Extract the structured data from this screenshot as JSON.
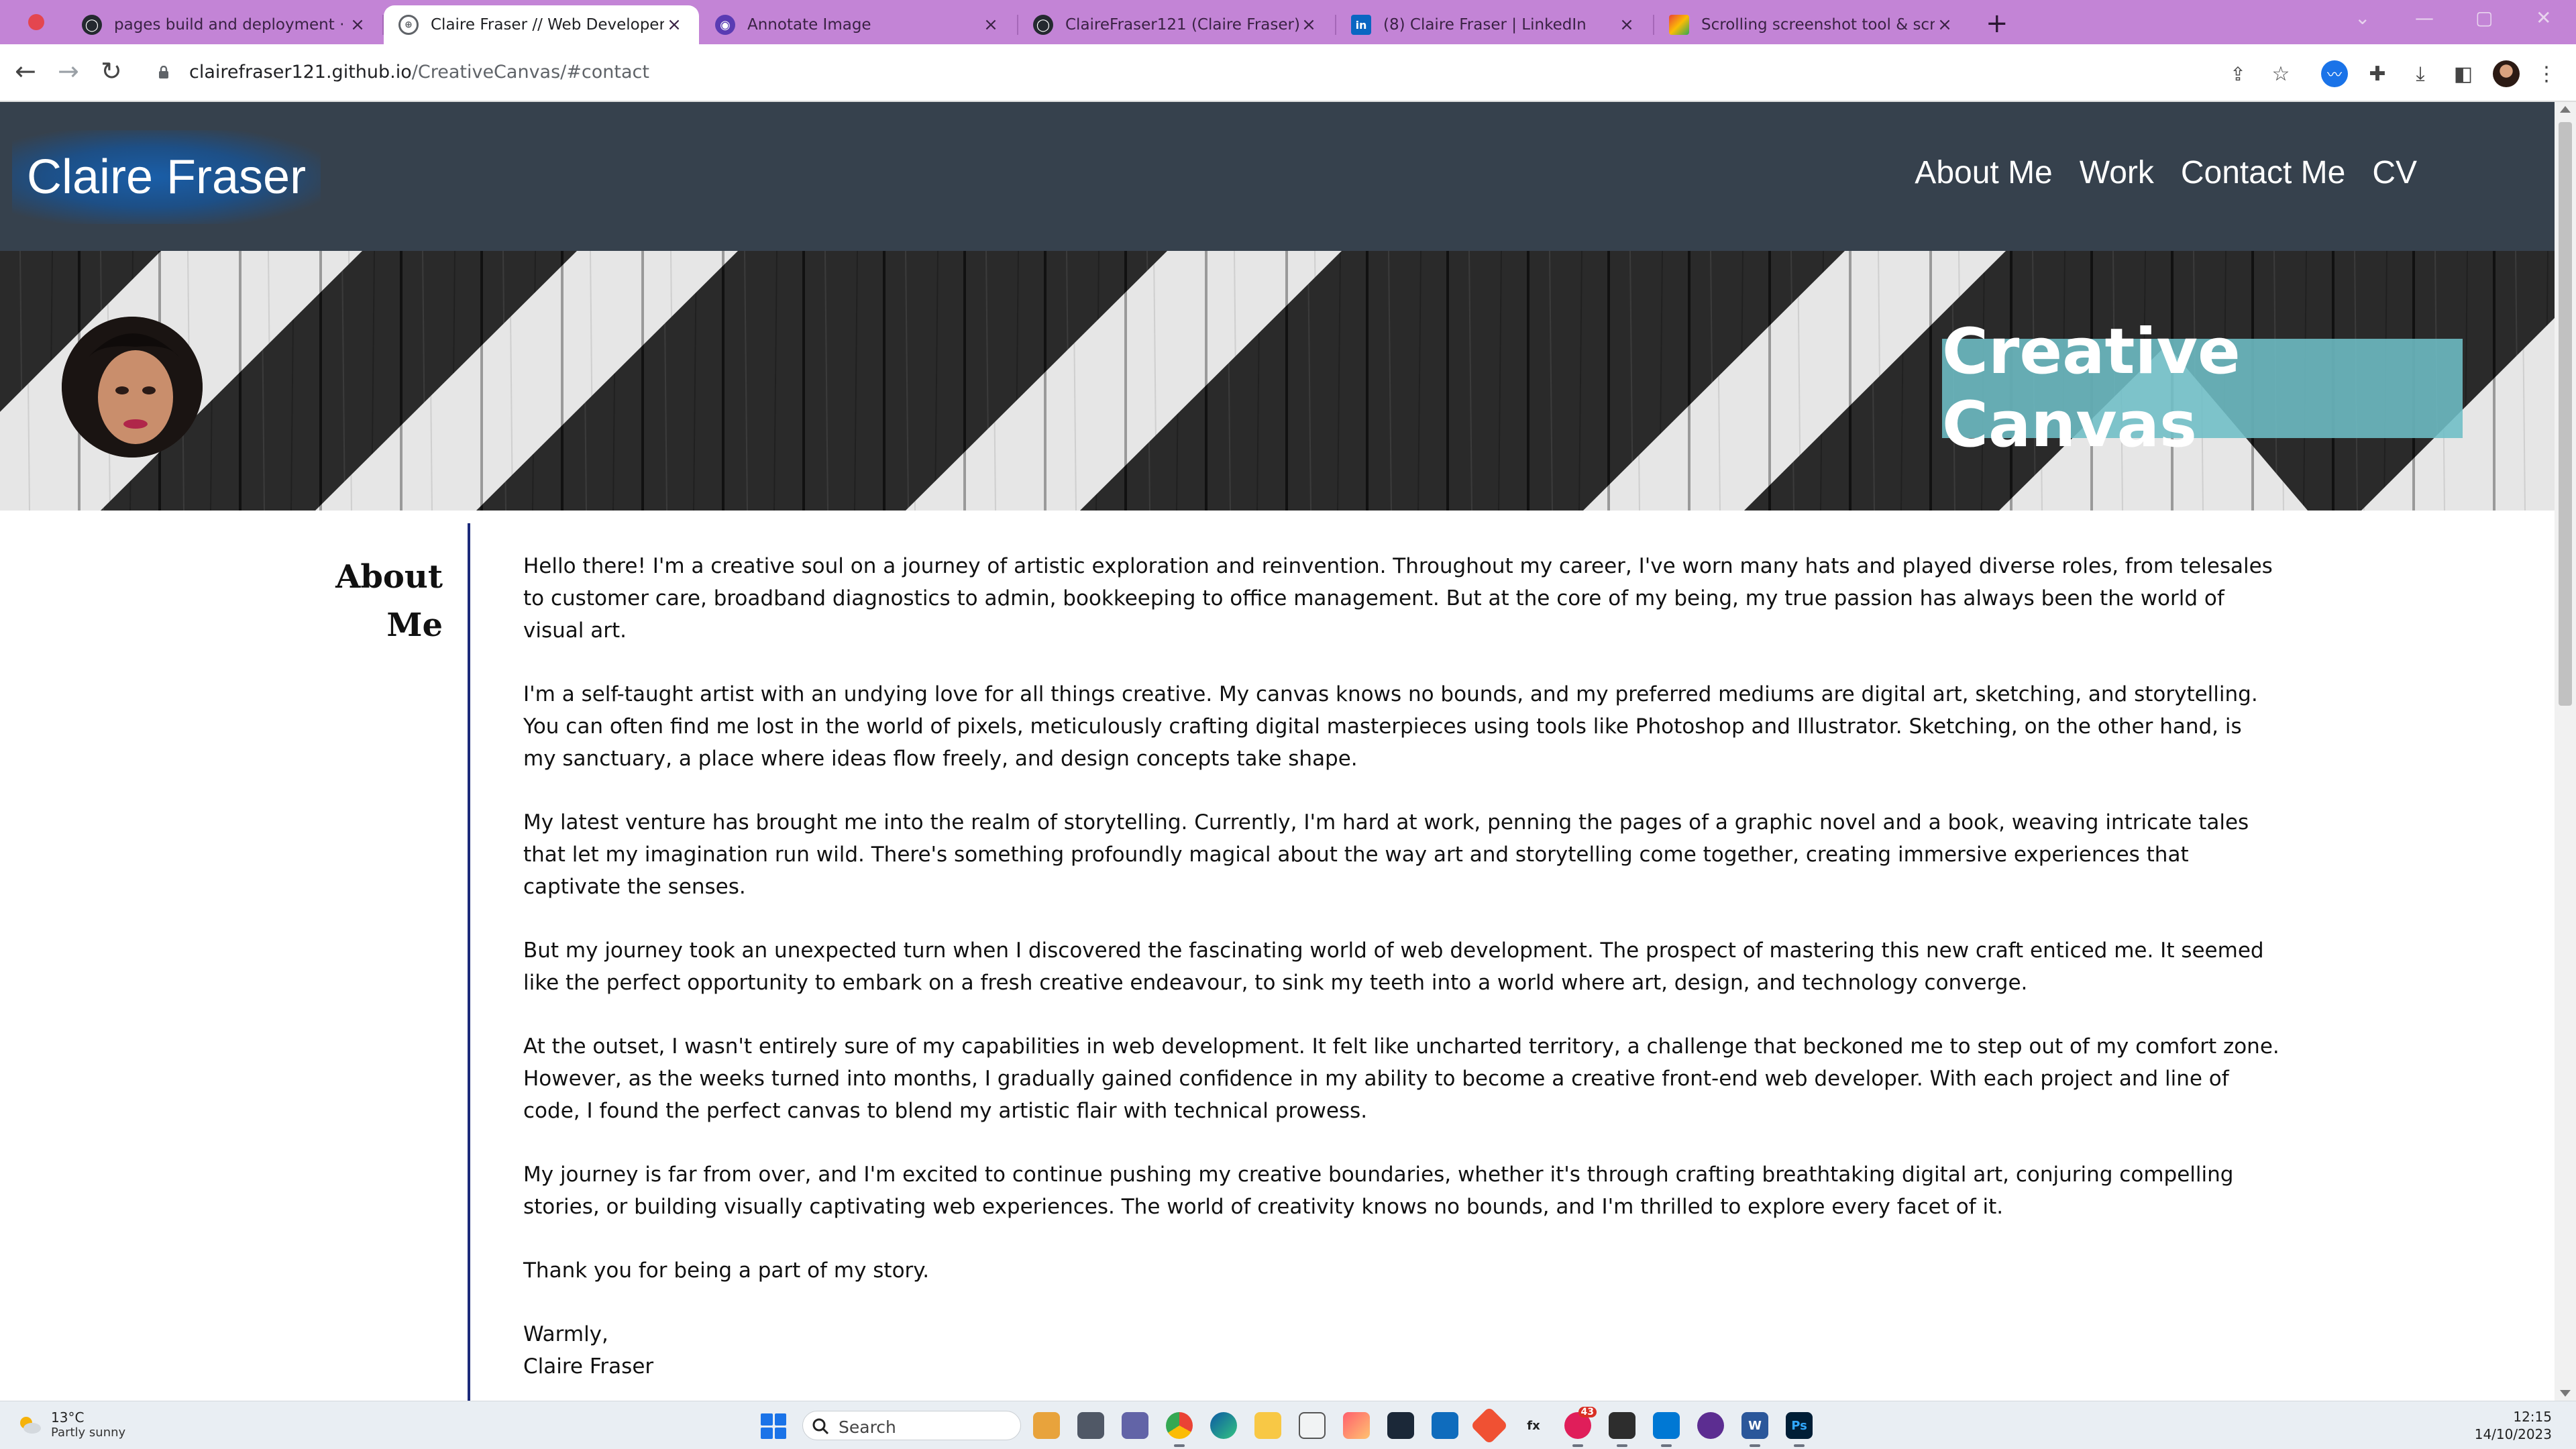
{
  "browser": {
    "tabs": [
      {
        "title": "pages build and deployment · Clai",
        "favicon": "github-icon",
        "active": false
      },
      {
        "title": "Claire Fraser // Web Developer",
        "favicon": "globe-icon",
        "active": true
      },
      {
        "title": "Annotate Image",
        "favicon": "annotate-icon",
        "active": false
      },
      {
        "title": "ClaireFraser121 (Claire Fraser)",
        "favicon": "github-icon",
        "active": false
      },
      {
        "title": "(8) Claire Fraser | LinkedIn",
        "favicon": "linkedin-icon",
        "active": false
      },
      {
        "title": "Scrolling screenshot tool & screen",
        "favicon": "screenshot-tool-icon",
        "active": false
      }
    ],
    "close_glyph": "×",
    "new_tab_glyph": "+",
    "url_host": "clairefraser121.github.io",
    "url_path": "/CreativeCanvas/#contact"
  },
  "site": {
    "brand": "Claire Fraser",
    "nav": [
      "About Me",
      "Work",
      "Contact Me",
      "CV"
    ],
    "hero_title": "Creative Canvas"
  },
  "about": {
    "heading_line1": "About",
    "heading_line2": "Me",
    "paragraphs": [
      "Hello there! I'm a creative soul on a journey of artistic exploration and reinvention. Throughout my career, I've worn many hats and played diverse roles, from telesales to customer care, broadband diagnostics to admin, bookkeeping to office management. But at the core of my being, my true passion has always been the world of visual art.",
      "I'm a self-taught artist with an undying love for all things creative. My canvas knows no bounds, and my preferred mediums are digital art, sketching, and storytelling. You can often find me lost in the world of pixels, meticulously crafting digital masterpieces using tools like Photoshop and Illustrator. Sketching, on the other hand, is my sanctuary, a place where ideas flow freely, and design concepts take shape.",
      "My latest venture has brought me into the realm of storytelling. Currently, I'm hard at work, penning the pages of a graphic novel and a book, weaving intricate tales that let my imagination run wild. There's something profoundly magical about the way art and storytelling come together, creating immersive experiences that captivate the senses.",
      "But my journey took an unexpected turn when I discovered the fascinating world of web development. The prospect of mastering this new craft enticed me. It seemed like the perfect opportunity to embark on a fresh creative endeavour, to sink my teeth into a world where art, design, and technology converge.",
      "At the outset, I wasn't entirely sure of my capabilities in web development. It felt like uncharted territory, a challenge that beckoned me to step out of my comfort zone. However, as the weeks turned into months, I gradually gained confidence in my ability to become a creative front-end web developer. With each project and line of code, I found the perfect canvas to blend my artistic flair with technical prowess.",
      "My journey is far from over, and I'm excited to continue pushing my creative boundaries, whether it's through crafting breathtaking digital art, conjuring compelling stories, or building visually captivating web experiences. The world of creativity knows no bounds, and I'm thrilled to explore every facet of it.",
      "Thank you for being a part of my story."
    ],
    "signoff_line1": "Warmly,",
    "signoff_line2": "Claire Fraser"
  },
  "taskbar": {
    "weather_temp": "13°C",
    "weather_desc": "Partly sunny",
    "search_placeholder": "Search",
    "time": "12:15",
    "date": "14/10/2023",
    "apps": [
      "files-icon",
      "task-view-icon",
      "teams-icon",
      "chrome-icon",
      "edge-icon",
      "file-explorer-icon",
      "store-icon",
      "photos-icon",
      "steam-icon",
      "outlook-icon",
      "git-icon",
      "fx-icon",
      "slack-icon",
      "terminal-icon",
      "vscode-icon",
      "media-icon",
      "word-icon",
      "photoshop-icon"
    ],
    "slack_badge": "43"
  },
  "colors": {
    "tabbar": "#c384d6",
    "header": "#36414d",
    "accent_line": "#1c2a7a",
    "badge": "#6ebec6"
  }
}
